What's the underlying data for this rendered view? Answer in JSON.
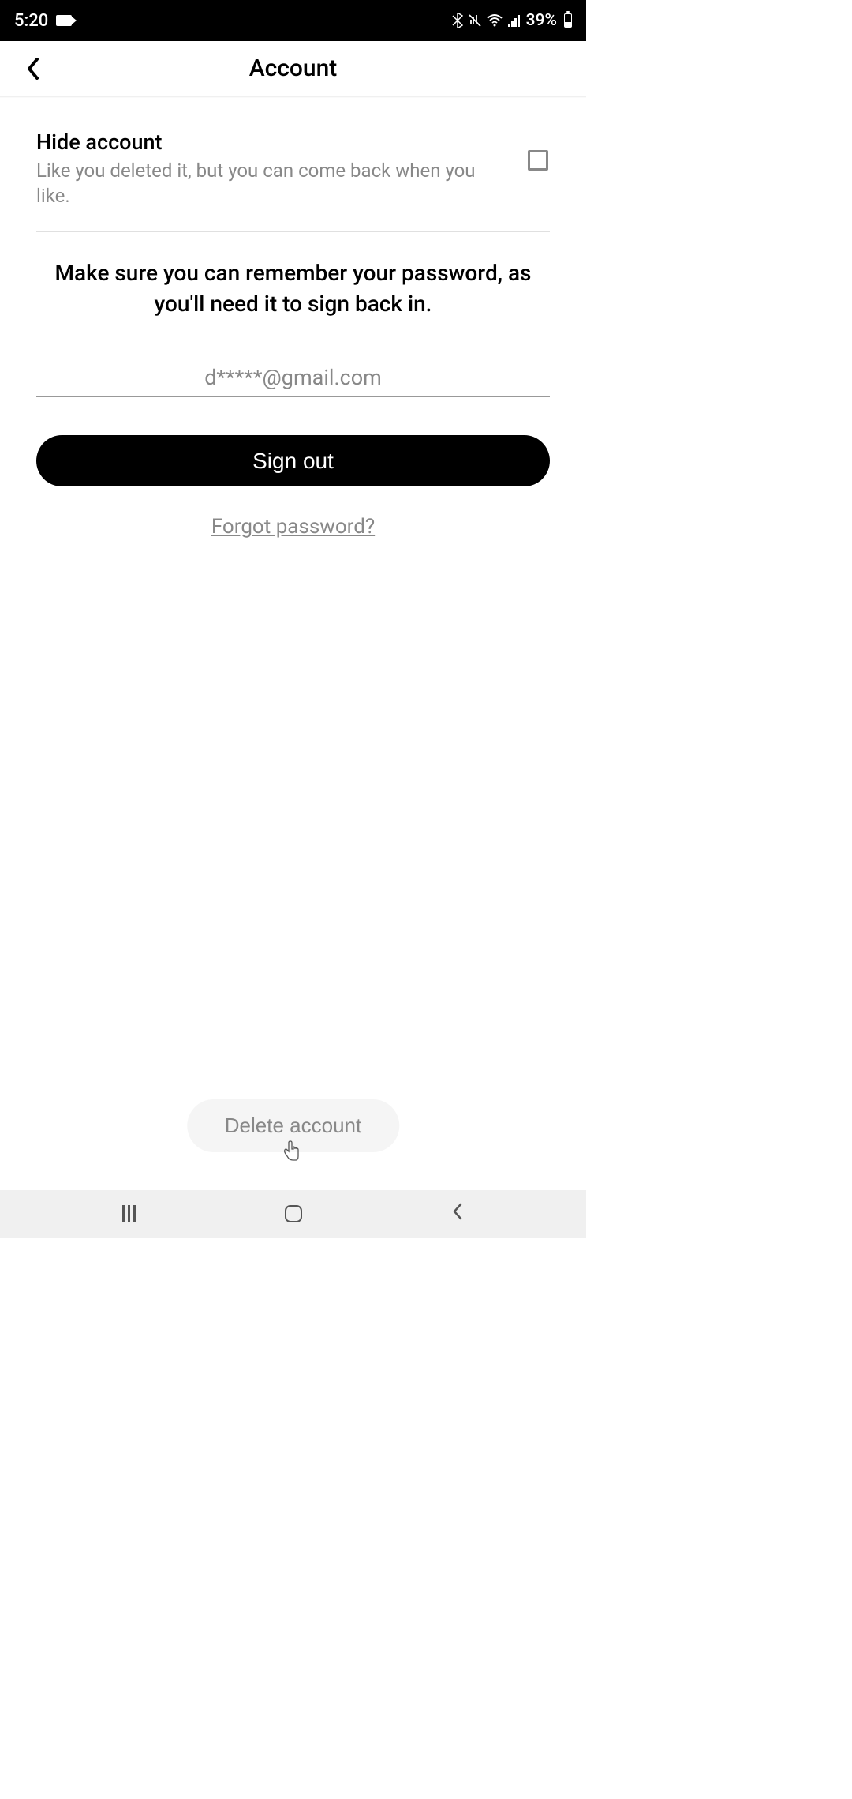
{
  "status_bar": {
    "time": "5:20",
    "battery": "39%"
  },
  "header": {
    "title": "Account"
  },
  "hide_account": {
    "title": "Hide account",
    "description": "Like you deleted it, but you can come back when you like."
  },
  "reminder": "Make sure you can remember your password, as you'll need it to sign back in.",
  "email": "d*****@gmail.com",
  "buttons": {
    "sign_out": "Sign out",
    "forgot_password": "Forgot password?",
    "delete_account": "Delete account"
  }
}
